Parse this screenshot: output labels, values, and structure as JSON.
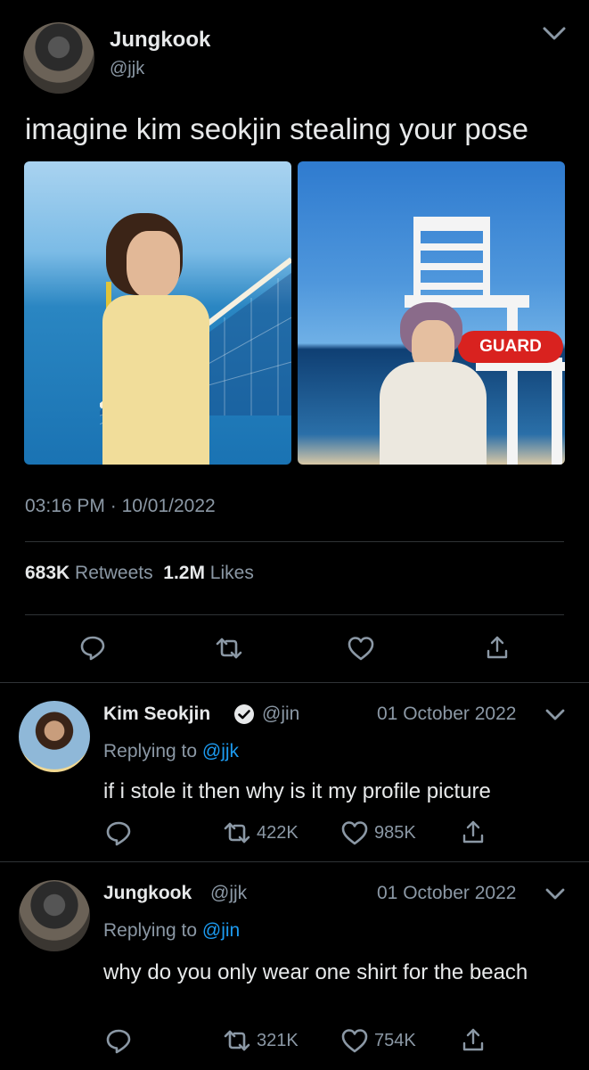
{
  "main_tweet": {
    "author_name": "Jungkook",
    "author_handle": "@jjk",
    "text": "imagine kim seokjin stealing your pose",
    "media_caption_right": "GUARD",
    "time": "03:16 PM",
    "separator": "·",
    "date": "10/01/2022",
    "retweets_count": "683K",
    "retweets_label": "Retweets",
    "likes_count": "1.2M",
    "likes_label": "Likes"
  },
  "replies": [
    {
      "author_name": "Kim Seokjin",
      "author_handle": "@jin",
      "date": "01 October 2022",
      "replying_prefix": "Replying to",
      "replying_to": "@jjk",
      "text": "if i stole it then why is it my profile picture",
      "retweets": "422K",
      "likes": "985K",
      "verified": true
    },
    {
      "author_name": "Jungkook",
      "author_handle": "@jjk",
      "date": "01 October 2022",
      "replying_prefix": "Replying to",
      "replying_to": "@jin",
      "text": "why do you only wear one shirt for the beach",
      "retweets": "321K",
      "likes": "754K",
      "verified": false
    }
  ],
  "icons": [
    "chevron-down-icon",
    "reply-icon",
    "retweet-icon",
    "like-icon",
    "share-icon",
    "verified-icon"
  ],
  "colors": {
    "background": "#000000",
    "text": "#e7e9ea",
    "muted": "#8b98a5",
    "link": "#1d9bf0",
    "divider": "#2f3336"
  }
}
